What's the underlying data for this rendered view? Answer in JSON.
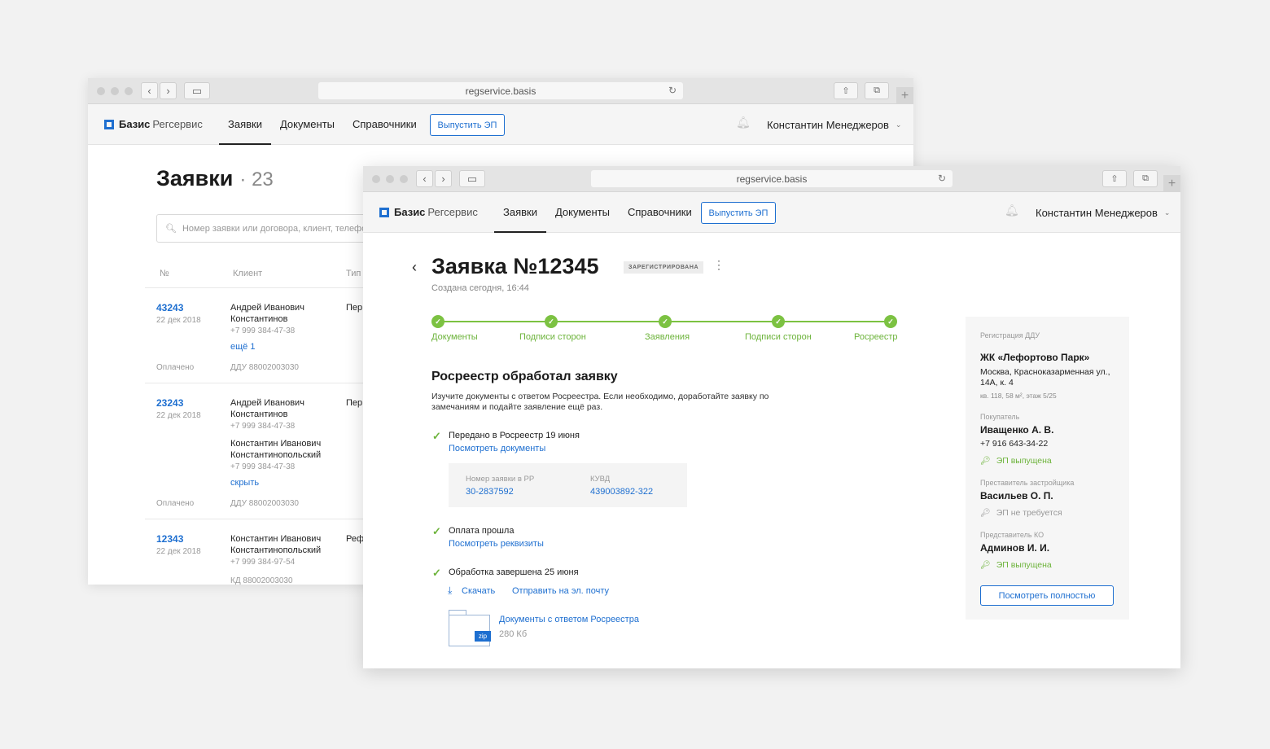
{
  "browser": {
    "url": "regservice.basis",
    "reload_icon": "reload-icon",
    "plus": "+"
  },
  "app": {
    "logo_bold": "Базис",
    "logo_light": "Регсервис",
    "nav": [
      "Заявки",
      "Документы",
      "Справочники"
    ],
    "active_nav": "Заявки",
    "issue_button": "Выпустить ЭП",
    "user_name": "Константин Менеджеров",
    "accent": "#1e6fd0",
    "success": "#7cc242"
  },
  "list": {
    "title": "Заявки",
    "count": "· 23",
    "search_placeholder": "Номер заявки или договора, клиент, телефон",
    "columns": [
      "№",
      "Клиент",
      "Тип"
    ],
    "rows": [
      {
        "number": "43243",
        "date": "22 дек 2018",
        "status": "Оплачено",
        "client1_name": "Андрей Иванович Константинов",
        "client1_phone": "+7 999 384-47-38",
        "client2_name": "",
        "client2_phone": "",
        "more": "ещё 1",
        "contract": "ДДУ 88002003030",
        "type": "Пер"
      },
      {
        "number": "23243",
        "date": "22 дек 2018",
        "status": "Оплачено",
        "client1_name": "Андрей Иванович Константинов",
        "client1_phone": "+7 999 384-47-38",
        "client2_name": "Константин Иванович Константинопольский",
        "client2_phone": "+7 999 384-47-38",
        "more": "скрыть",
        "contract": "ДДУ 88002003030",
        "type": "Пер"
      },
      {
        "number": "12343",
        "date": "22 дек 2018",
        "status": "",
        "client1_name": "Константин Иванович Константинопольский",
        "client1_phone": "+7 999 384-97-54",
        "client2_name": "",
        "client2_phone": "",
        "more": "",
        "contract": "КД 88002003030",
        "type": "Реф"
      }
    ]
  },
  "detail": {
    "back_icon": "‹",
    "title": "Заявка №12345",
    "status": "ЗАРЕГИСТРИРОВАНА",
    "more_icon": "⋮",
    "created": "Создана сегодня, 16:44",
    "steps": [
      "Документы",
      "Подписи сторон",
      "Заявления",
      "Подписи сторон",
      "Росреестр"
    ],
    "steps_completed": 5,
    "section_title": "Росреестр обработал заявку",
    "section_desc": "Изучите документы с ответом Росреестра. Если необходимо, доработайте заявку по замечаниям и подайте заявление ещё раз.",
    "events": [
      {
        "text": "Передано в Росреестр 19 июня",
        "link": "Посмотреть документы"
      },
      {
        "text": "Оплата прошла",
        "link": "Посмотреть реквизиты"
      },
      {
        "text": "Обработка завершена 25 июня",
        "link": ""
      }
    ],
    "rr_number_label": "Номер заявки в РР",
    "rr_number": "30-2837592",
    "kuvd_label": "КУВД",
    "kuvd": "439003892-322",
    "download": "Скачать",
    "send_email": "Отправить на эл. почту",
    "zip_label": "zip",
    "file_name": "Документы с ответом Росреестра",
    "file_size": "280 Кб"
  },
  "card": {
    "reg_label": "Регистрация ДДУ",
    "object_name": "ЖК «Лефортово Парк»",
    "address": "Москва, Красноказарменная ул., 14А, к. 4",
    "details": "кв. 118, 58 м², этаж 5/25",
    "buyer_label": "Покупатель",
    "buyer_name": "Иващенко А. В.",
    "buyer_phone": "+7 916 643-34-22",
    "buyer_ep": "ЭП выпущена",
    "dev_label": "Преставитель застройщика",
    "dev_name": "Васильев О. П.",
    "dev_ep": "ЭП не требуется",
    "ko_label": "Представитель КО",
    "ko_name": "Админов И. И.",
    "ko_ep": "ЭП выпущена",
    "button": "Посмотреть полностью"
  }
}
